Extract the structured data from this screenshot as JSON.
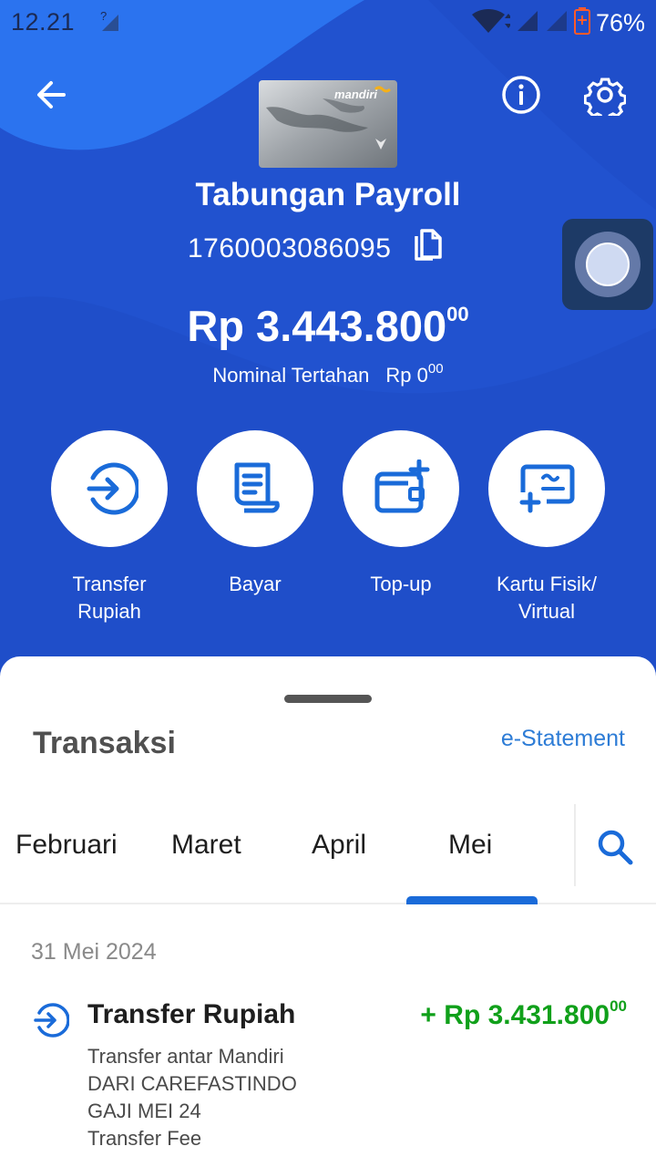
{
  "status_bar": {
    "time": "12.21",
    "battery": "76%"
  },
  "account": {
    "card_brand": "mandiri",
    "name": "Tabungan Payroll",
    "number": "1760003086095"
  },
  "balance": {
    "amount": "Rp 3.443.800",
    "decimals": "00",
    "hold_label": "Nominal Tertahan",
    "hold_amount": "Rp 0",
    "hold_decimals": "00"
  },
  "actions": [
    {
      "label": "Transfer\nRupiah",
      "icon": "transfer-icon"
    },
    {
      "label": "Bayar",
      "icon": "bill-icon"
    },
    {
      "label": "Top-up",
      "icon": "wallet-plus-icon"
    },
    {
      "label": "Kartu Fisik/\nVirtual",
      "icon": "card-plus-icon"
    }
  ],
  "transactions_panel": {
    "title": "Transaksi",
    "estatement_label": "e-Statement",
    "tabs": [
      "Februari",
      "Maret",
      "April",
      "Mei"
    ],
    "active_tab": "Mei",
    "date": "31 Mei 2024",
    "items": [
      {
        "title": "Transfer Rupiah",
        "amount": "+ Rp 3.431.800",
        "decimals": "00",
        "description": [
          "Transfer antar Mandiri",
          "DARI CAREFASTINDO",
          "GAJI MEI 24",
          "Transfer Fee"
        ]
      }
    ]
  },
  "colors": {
    "primary_blue": "#2152cf",
    "accent_blue": "#1a6bd9",
    "credit_green": "#10a01a"
  }
}
